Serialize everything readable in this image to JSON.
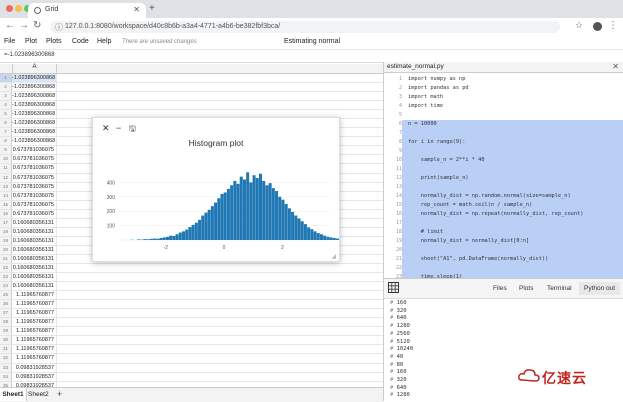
{
  "browser": {
    "tab_title": "Grid",
    "url": "127.0.0.1:8080/workspace/d40c8b6b-a3a4-4771-a4b6-be382fbf3bca/",
    "colors": {
      "red": "#ec6a5e",
      "yellow": "#f4bf4f",
      "green": "#61c554"
    }
  },
  "menu": {
    "items": [
      "File",
      "Plot",
      "Plots",
      "Code",
      "Help"
    ],
    "unsaved": "There are unsaved changes",
    "status": "Estimating normal"
  },
  "formula_bar": "=-1.023896300868",
  "grid": {
    "column": "A",
    "rows": [
      {
        "n": "1",
        "v": "-1.023896300868"
      },
      {
        "n": "2",
        "v": "-1.023896300868"
      },
      {
        "n": "3",
        "v": "-1.023896300868"
      },
      {
        "n": "4",
        "v": "-1.023896300868"
      },
      {
        "n": "5",
        "v": "-1.023896300868"
      },
      {
        "n": "6",
        "v": "-1.023896300868"
      },
      {
        "n": "7",
        "v": "-1.023896300868"
      },
      {
        "n": "8",
        "v": "-1.023896300868"
      },
      {
        "n": "9",
        "v": "0.673781036075"
      },
      {
        "n": "10",
        "v": "0.673781036075"
      },
      {
        "n": "11",
        "v": "0.673781036075"
      },
      {
        "n": "12",
        "v": "0.673781036075"
      },
      {
        "n": "13",
        "v": "0.673781036075"
      },
      {
        "n": "14",
        "v": "0.673781036075"
      },
      {
        "n": "15",
        "v": "0.673781036075"
      },
      {
        "n": "16",
        "v": "0.673781036075"
      },
      {
        "n": "17",
        "v": "0.160680356131"
      },
      {
        "n": "18",
        "v": "0.160680356131"
      },
      {
        "n": "19",
        "v": "0.160680356131"
      },
      {
        "n": "20",
        "v": "0.160680356131"
      },
      {
        "n": "21",
        "v": "0.160680356131"
      },
      {
        "n": "22",
        "v": "0.160680356131"
      },
      {
        "n": "23",
        "v": "0.160680356131"
      },
      {
        "n": "24",
        "v": "0.160680356131"
      },
      {
        "n": "25",
        "v": "1.11965760877"
      },
      {
        "n": "26",
        "v": "1.11965760877"
      },
      {
        "n": "27",
        "v": "1.11965760877"
      },
      {
        "n": "28",
        "v": "1.11965760877"
      },
      {
        "n": "29",
        "v": "1.11965760877"
      },
      {
        "n": "30",
        "v": "1.11965760877"
      },
      {
        "n": "31",
        "v": "1.11965760877"
      },
      {
        "n": "32",
        "v": "1.11965760877"
      },
      {
        "n": "33",
        "v": "0.09831928537"
      },
      {
        "n": "34",
        "v": "0.09831928537"
      },
      {
        "n": "35",
        "v": "0.09831928537"
      }
    ]
  },
  "sheets": [
    "Sheet1",
    "Sheet2"
  ],
  "histogram": {
    "title": "Histogram plot",
    "chart_data": {
      "type": "bar",
      "title": "Histogram plot",
      "xticks": [
        "-2",
        "0",
        "2"
      ],
      "yticks": [
        "0",
        "100",
        "200",
        "300",
        "400"
      ],
      "ylim": [
        0,
        500
      ],
      "xlim": [
        -3.6,
        3.6
      ],
      "bin_start": -3.2,
      "bin_width": 0.11,
      "values": [
        2,
        0,
        4,
        3,
        6,
        5,
        8,
        10,
        9,
        14,
        18,
        22,
        30,
        28,
        40,
        52,
        60,
        72,
        90,
        105,
        120,
        140,
        170,
        190,
        210,
        235,
        260,
        290,
        320,
        330,
        355,
        380,
        410,
        390,
        440,
        420,
        470,
        400,
        450,
        430,
        460,
        410,
        380,
        395,
        360,
        340,
        300,
        280,
        250,
        220,
        195,
        170,
        150,
        130,
        110,
        88,
        75,
        60,
        48,
        40,
        30,
        22,
        18,
        14,
        10,
        8,
        5,
        4,
        3,
        2
      ]
    },
    "color": "#1f77b4"
  },
  "editor": {
    "filename": "estimate_normal.py",
    "lines": [
      {
        "n": "1",
        "t": "import numpy as np"
      },
      {
        "n": "2",
        "t": "import pandas as pd"
      },
      {
        "n": "3",
        "t": "import math"
      },
      {
        "n": "4",
        "t": "import time"
      },
      {
        "n": "5",
        "t": ""
      },
      {
        "n": "6",
        "t": "n = 10000"
      },
      {
        "n": "7",
        "t": ""
      },
      {
        "n": "8",
        "t": "for i in range(9):"
      },
      {
        "n": "9",
        "t": ""
      },
      {
        "n": "10",
        "t": "    sample_n = 2**i * 40"
      },
      {
        "n": "11",
        "t": ""
      },
      {
        "n": "12",
        "t": "    print(sample_n)"
      },
      {
        "n": "13",
        "t": ""
      },
      {
        "n": "14",
        "t": "    normally_dist = np.random.normal(size=sample_n)"
      },
      {
        "n": "15",
        "t": "    rep_count = math.ceil(n / sample_n)"
      },
      {
        "n": "16",
        "t": "    normally_dist = np.repeat(normally_dist, rep_count)"
      },
      {
        "n": "17",
        "t": ""
      },
      {
        "n": "18",
        "t": "    # limit"
      },
      {
        "n": "19",
        "t": "    normally_dist = normally_dist[0:n]"
      },
      {
        "n": "20",
        "t": ""
      },
      {
        "n": "21",
        "t": "    sheet(\"A1\", pd.DataFrame(normally_dist))"
      },
      {
        "n": "22",
        "t": ""
      },
      {
        "n": "23",
        "t": "    time.sleep(1)"
      },
      {
        "n": "24",
        "t": ""
      }
    ]
  },
  "panel_tabs": [
    "Files",
    "Plots",
    "Terminal",
    "Python out"
  ],
  "console": [
    "160",
    "320",
    "640",
    "1280",
    "2560",
    "5120",
    "10240",
    "40",
    "80",
    "160",
    "320",
    "640",
    "1280"
  ],
  "logo_text": "亿速云"
}
